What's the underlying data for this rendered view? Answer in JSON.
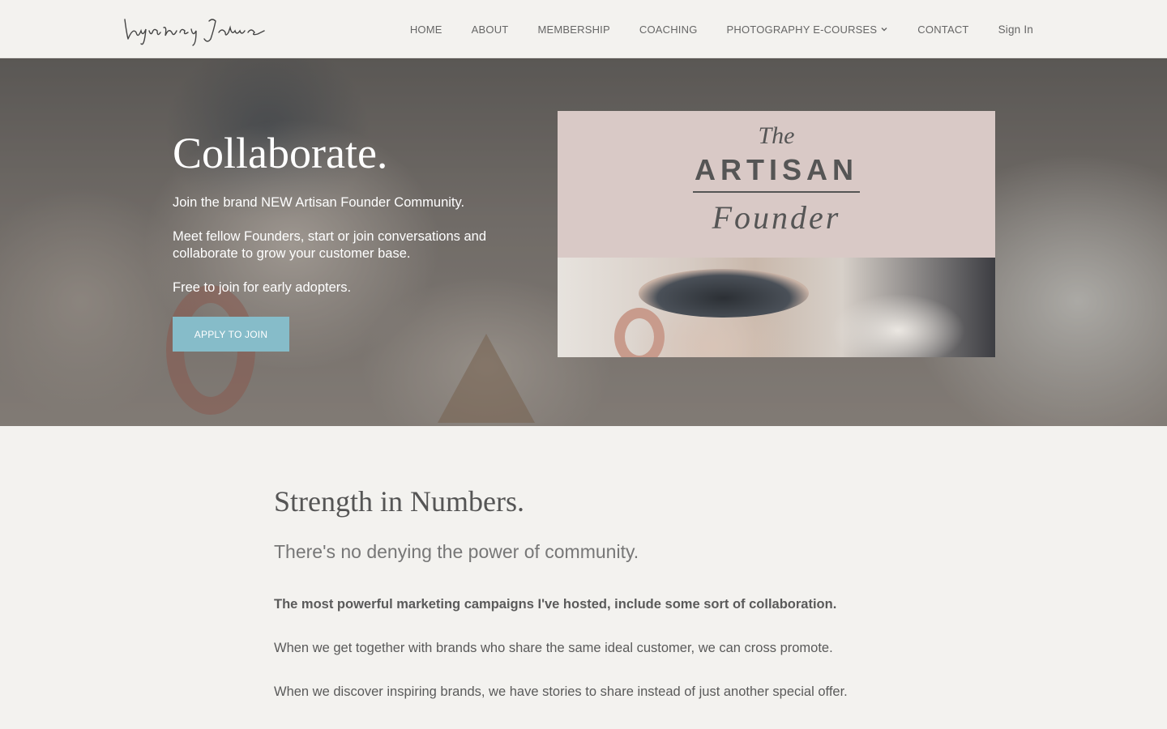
{
  "header": {
    "logo_text": "lyndsey James",
    "nav": [
      {
        "label": "HOME"
      },
      {
        "label": "ABOUT"
      },
      {
        "label": "MEMBERSHIP"
      },
      {
        "label": "COACHING"
      },
      {
        "label": "PHOTOGRAPHY E-COURSES"
      },
      {
        "label": "CONTACT"
      },
      {
        "label": "Sign In"
      }
    ]
  },
  "hero": {
    "title": "Collaborate.",
    "text1": "Join the brand NEW Artisan Founder Community.",
    "text2": "Meet fellow Founders, start or join conversations and collaborate to grow your customer base.",
    "text3": "Free to join for early adopters.",
    "button": "APPLY TO JOIN",
    "button_color": "#86bcc9",
    "card": {
      "the": "The",
      "artisan": "ARTISAN",
      "founder": "Founder"
    }
  },
  "section": {
    "heading": "Strength in Numbers.",
    "lead": "There's no denying the power of community.",
    "p1": "The most powerful marketing campaigns I've hosted, include some sort of collaboration.",
    "p2": "When we get together with brands who share the same ideal customer, we can cross promote.",
    "p3": "When we discover inspiring brands, we have stories to share instead of just another special offer."
  }
}
